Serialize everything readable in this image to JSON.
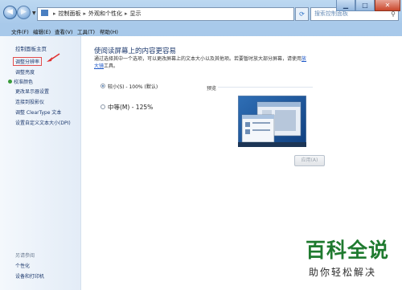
{
  "titlebar": {
    "breadcrumb": [
      "控制面板",
      "外观和个性化",
      "显示"
    ],
    "refresh_icon": "refresh-icon",
    "search_placeholder": "搜索控制面板",
    "window_controls": [
      "minimize-icon",
      "maximize-icon",
      "close-icon"
    ]
  },
  "menu": [
    "文件(F)",
    "编辑(E)",
    "查看(V)",
    "工具(T)",
    "帮助(H)"
  ],
  "sidebar": {
    "home": "控制面板主页",
    "links": [
      "调整分辨率",
      "调整亮度",
      "校准颜色",
      "更改显示器设置",
      "连接到投影仪",
      "调整 ClearType 文本",
      "设置自定义文本大小(DPI)"
    ],
    "active_index": 0,
    "see_also_title": "另请参阅",
    "see_also": [
      "个性化",
      "设备和打印机"
    ]
  },
  "main": {
    "heading": "使阅读屏幕上的内容更容易",
    "description": "通过选择其中一个选项，可以更改屏幕上的文本大小以及其他项。若要暂时放大部分屏幕，请使用",
    "magnifier_link": "放大镜",
    "description_end": "工具。",
    "options": [
      {
        "label": "较小(S) - 100% (默认)",
        "selected": true
      },
      {
        "label": "中等(M) - 125%",
        "selected": false
      }
    ],
    "preview_label": "预览",
    "apply_button": "应用(A)"
  },
  "watermark": {
    "title": "百科全说",
    "subtitle": "助你轻松解决"
  },
  "colors": {
    "link": "#1e3a6e",
    "highlight_box": "#e24d4d",
    "watermark_green": "#1f7a2f"
  }
}
